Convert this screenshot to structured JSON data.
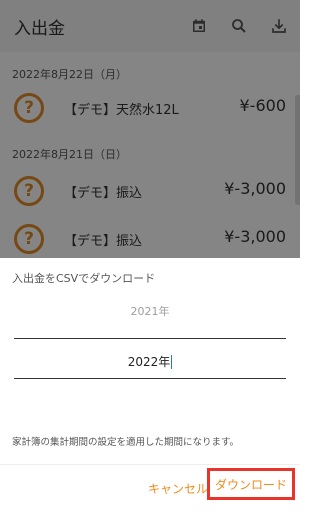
{
  "appbar": {
    "title": "入出金",
    "icons": [
      "calendar-icon",
      "search-icon",
      "download-icon"
    ]
  },
  "list": [
    {
      "date": "2022年8月22日（月）",
      "items": [
        {
          "label": "【デモ】天然水12L",
          "amount": "¥-600"
        }
      ]
    },
    {
      "date": "2022年8月21日（日）",
      "items": [
        {
          "label": "【デモ】振込",
          "amount": "¥-3,000"
        },
        {
          "label": "【デモ】振込",
          "amount": "¥-3,000"
        }
      ]
    }
  ],
  "dialog": {
    "title": "入出金をCSVでダウンロード",
    "picker_prev": "2021年",
    "picker_selected": "2022年",
    "note": "家計簿の集計期間の設定を適用した期間になります。",
    "cancel_label": "キャンセル",
    "download_label": "ダウンロード"
  },
  "colors": {
    "accent": "#f08a1c",
    "highlight_box": "#e8342a",
    "caret": "#1a8f7e"
  }
}
